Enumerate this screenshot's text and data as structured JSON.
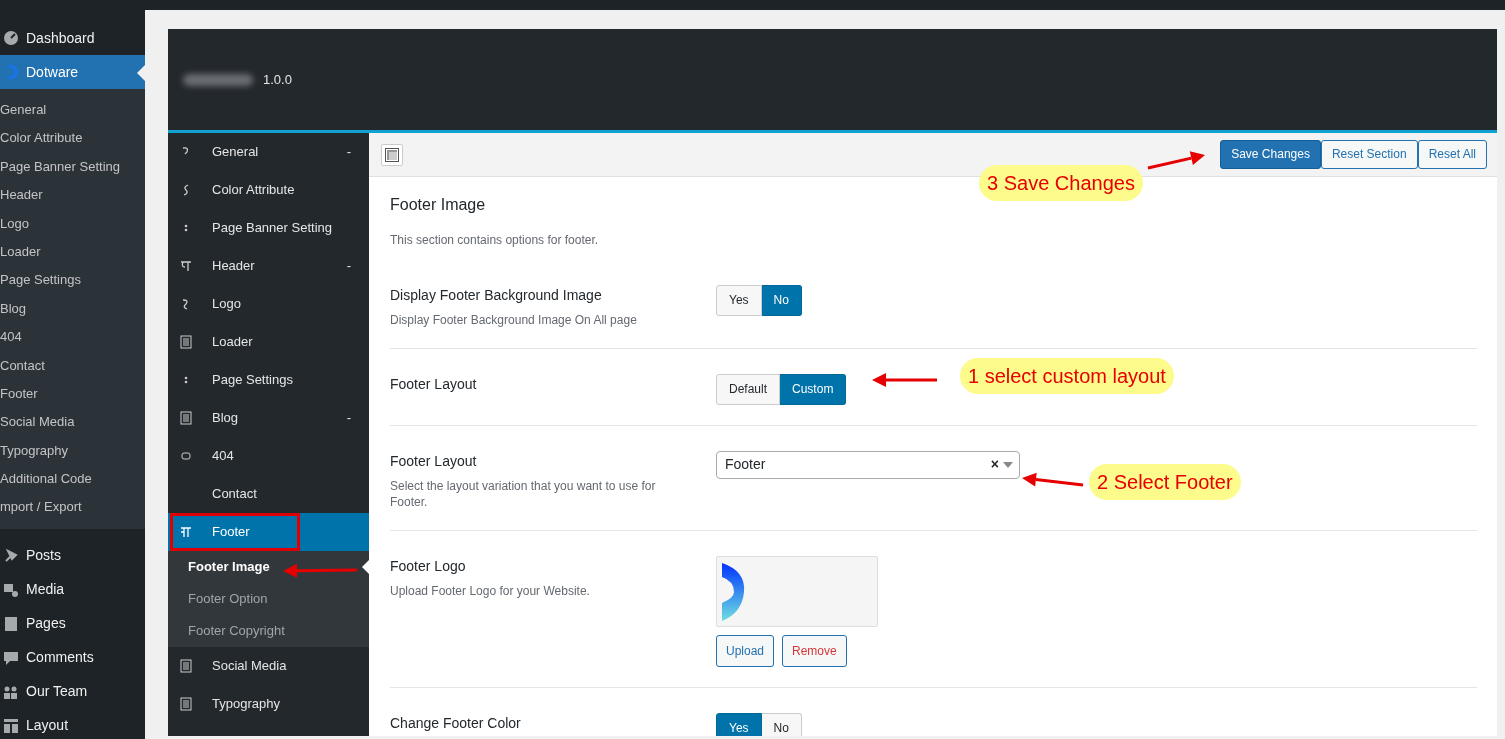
{
  "admin_menu": {
    "items": [
      {
        "label": "Dashboard",
        "selected": false
      },
      {
        "label": "Dotware",
        "selected": true,
        "children": [
          {
            "label": "General"
          },
          {
            "label": "Color Attribute"
          },
          {
            "label": "Page Banner Setting"
          },
          {
            "label": "Header"
          },
          {
            "label": "Logo"
          },
          {
            "label": "Loader"
          },
          {
            "label": "Page Settings"
          },
          {
            "label": "Blog"
          },
          {
            "label": "404"
          },
          {
            "label": "Contact"
          },
          {
            "label": "Footer"
          },
          {
            "label": "Social Media"
          },
          {
            "label": "Typography"
          },
          {
            "label": "Additional Code"
          },
          {
            "label": "mport / Export"
          }
        ]
      },
      {
        "label": "Posts",
        "selected": false
      },
      {
        "label": "Media",
        "selected": false
      },
      {
        "label": "Pages",
        "selected": false
      },
      {
        "label": "Comments",
        "selected": false
      },
      {
        "label": "Our Team",
        "selected": false
      },
      {
        "label": "Layout",
        "selected": false
      }
    ]
  },
  "panel_header": {
    "version": "1.0.0"
  },
  "options_menu": {
    "items": [
      {
        "label": "General",
        "toggle": "-",
        "selected": false,
        "has_icon": true
      },
      {
        "label": "Color Attribute",
        "selected": false,
        "has_icon": true
      },
      {
        "label": "Page Banner Setting",
        "selected": false,
        "has_icon": true
      },
      {
        "label": "Header",
        "toggle": "-",
        "selected": false,
        "has_icon": true
      },
      {
        "label": "Logo",
        "selected": false,
        "has_icon": true
      },
      {
        "label": "Loader",
        "selected": false,
        "has_icon": true
      },
      {
        "label": "Page Settings",
        "selected": false,
        "has_icon": true
      },
      {
        "label": "Blog",
        "toggle": "-",
        "selected": false,
        "has_icon": true
      },
      {
        "label": "404",
        "selected": false,
        "has_icon": true
      },
      {
        "label": "Contact",
        "selected": false,
        "has_icon": false
      },
      {
        "label": "Footer",
        "selected": true,
        "has_icon": true,
        "children": [
          {
            "label": "Footer Image",
            "selected": true
          },
          {
            "label": "Footer Option",
            "selected": false
          },
          {
            "label": "Footer Copyright",
            "selected": false
          }
        ]
      },
      {
        "label": "Social Media",
        "selected": false,
        "has_icon": true
      },
      {
        "label": "Typography",
        "selected": false,
        "has_icon": true
      }
    ]
  },
  "toolbar": {
    "buttons": [
      {
        "label": "Save Changes",
        "kind": "primary"
      },
      {
        "label": "Reset Section",
        "kind": "secondary"
      },
      {
        "label": "Reset All",
        "kind": "secondary"
      }
    ]
  },
  "section": {
    "title": "Footer Image",
    "description": "This section contains options for footer.",
    "fields": [
      {
        "kind": "toggle",
        "label": "Display Footer Background Image",
        "description": "Display Footer Background Image On All page",
        "options": [
          {
            "label": "Yes",
            "selected": false
          },
          {
            "label": "No",
            "selected": true
          }
        ]
      },
      {
        "kind": "toggle",
        "label": "Footer Layout",
        "options": [
          {
            "label": "Default",
            "selected": false
          },
          {
            "label": "Custom",
            "selected": true
          }
        ]
      },
      {
        "kind": "select",
        "label": "Footer Layout",
        "description": "Select the layout variation that you want to use for Footer.",
        "value": "Footer",
        "clear": "×"
      },
      {
        "kind": "media",
        "label": "Footer Logo",
        "description": "Upload Footer Logo for your Website.",
        "buttons": [
          {
            "label": "Upload",
            "kind": "upload"
          },
          {
            "label": "Remove",
            "kind": "remove"
          }
        ]
      },
      {
        "kind": "toggle",
        "label": "Change Footer Color",
        "options": [
          {
            "label": "Yes",
            "selected": true
          },
          {
            "label": "No",
            "selected": false
          }
        ]
      }
    ]
  },
  "annotations": [
    {
      "kind": "callout",
      "text": "3 Save Changes"
    },
    {
      "kind": "callout",
      "text": "1 select custom layout"
    },
    {
      "kind": "callout",
      "text": "2 Select Footer"
    },
    {
      "kind": "arrow"
    },
    {
      "kind": "arrow"
    },
    {
      "kind": "arrow"
    },
    {
      "kind": "arrow"
    },
    {
      "kind": "frame"
    }
  ]
}
